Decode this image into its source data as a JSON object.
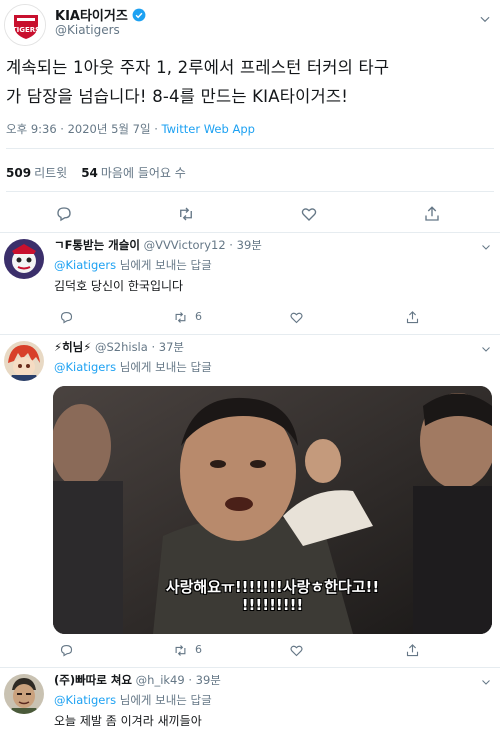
{
  "main_tweet": {
    "display_name": "KIA타이거즈",
    "handle": "@Kiatigers",
    "logo_text": "TIGERS",
    "text_line1": "계속되는 1아웃 주자 1, 2루에서 프레스턴 터커의 타구",
    "text_line2": "가 담장을 넘습니다! 8-4를 만드는 KIA타이거즈!",
    "timestamp": "오후 9:36 · 2020년 5월 7일 · ",
    "source": "Twitter Web App",
    "retweets_count": "509",
    "retweets_label": "리트윗",
    "likes_count": "54",
    "likes_label": "마음에 들어요 수"
  },
  "replies": [
    {
      "display_name": "ㄱF통받는 개슬이",
      "handle": "@VVVictory12 · 39분",
      "reply_to_mention": "@Kiatigers",
      "reply_to_suffix": " 님에게 보내는 답글",
      "text": "김덕호 당신이 한국입니다",
      "retweets": "6"
    },
    {
      "display_name": "⚡히님⚡",
      "handle": "@S2hisla · 37분",
      "reply_to_mention": "@Kiatigers",
      "reply_to_suffix": " 님에게 보내는 답글",
      "media_caption_line1": "사랑해요ㅠ!!!!!!!사랑ㅎ한다고!!",
      "media_caption_line2": "!!!!!!!!!",
      "retweets": "6"
    },
    {
      "display_name": "(주)빠따로 쳐요",
      "handle": "@h_ik49 · 39분",
      "reply_to_mention": "@Kiatigers",
      "reply_to_suffix": " 님에게 보내는 답글",
      "text": "오늘 제발 좀 이겨라 새끼들아"
    }
  ],
  "colors": {
    "accent": "#1da1f2",
    "secondary_text": "#657786",
    "brand_red": "#c8102e"
  }
}
